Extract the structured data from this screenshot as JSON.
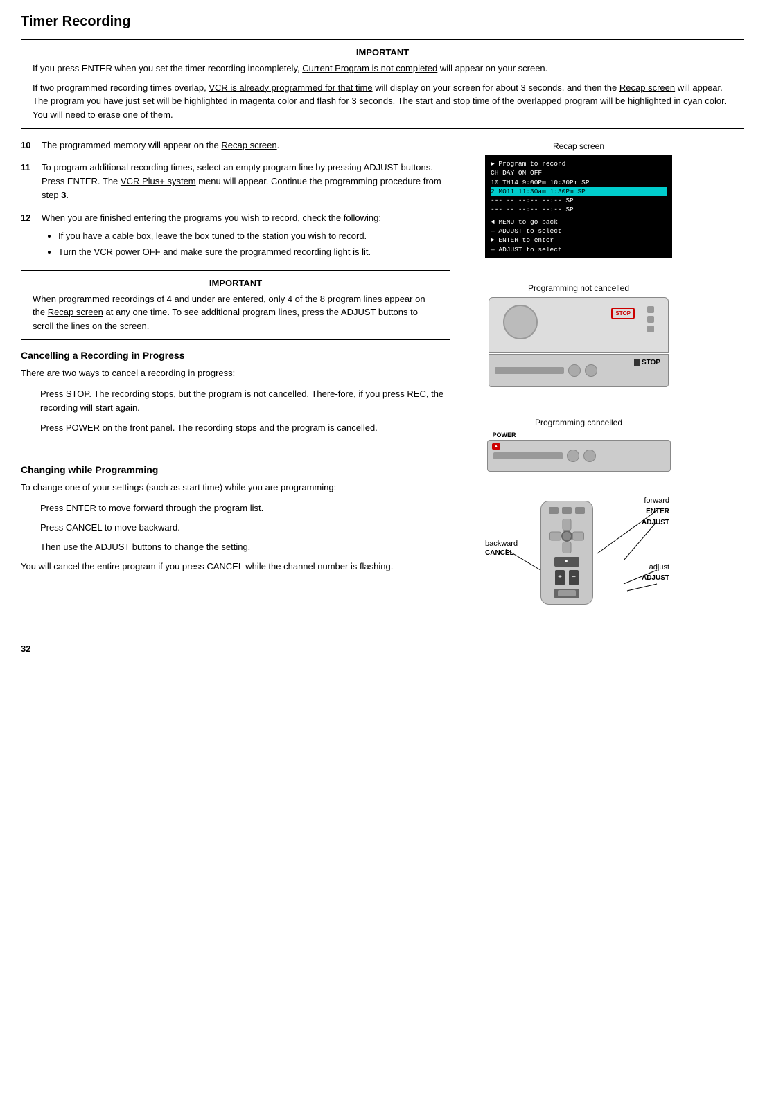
{
  "page": {
    "title": "Timer Recording",
    "page_number": "32"
  },
  "important_box_1": {
    "title": "IMPORTANT",
    "para1": "If you press ENTER when you set the timer recording incompletely, Current Program is not completed will appear on your screen.",
    "para1_underline": "Current Program is not completed",
    "para2_prefix": "If two programmed recording times overlap, ",
    "para2_underline": "VCR is already programmed for that time",
    "para2_mid": " will display on your screen for about 3 seconds, and then the ",
    "para2_underline2": "Recap screen",
    "para2_suffix": " will appear.  The program you have just set will be highlighted in magenta color and flash for 3 seconds.  The start and stop time of the overlapped program will be highlighted in cyan color.  You will need to erase one of them."
  },
  "steps": {
    "step10_num": "10",
    "step10_text": "The programmed memory will appear on the ",
    "step10_underline": "Recap screen",
    "step10_suffix": ".",
    "step11_num": "11",
    "step11_prefix": "To program additional recording times, select an empty program line by pressing ADJUST buttons.  Press ENTER.  The ",
    "step11_underline": "VCR Plus+ system",
    "step11_suffix": " menu will appear.  Continue the programming procedure from step ",
    "step11_bold": "3",
    "step11_end": ".",
    "step12_num": "12",
    "step12_text": "When you are finished entering the programs you wish to record, check the following:",
    "step12_bullet1": "If you have a cable box, leave the box tuned to the station you wish to record.",
    "step12_bullet2": "Turn the VCR power OFF and make sure the programmed recording light is lit."
  },
  "important_box_2": {
    "title": "IMPORTANT",
    "text": "When programmed recordings of 4 and under are entered, only 4 of the 8 program lines appear on the ",
    "underline": "Recap screen",
    "suffix": " at any one time.  To see additional program lines, press the ADJUST buttons to scroll the lines on the screen."
  },
  "cancelling_section": {
    "heading": "Cancelling a Recording in Progress",
    "intro": "There are two ways to cancel a recording in progress:",
    "method1": "Press STOP.  The recording stops, but the program is not cancelled.  There-fore, if you press REC, the recording will start again.",
    "method2": "Press POWER on the front panel.  The recording stops and the program is cancelled."
  },
  "changing_section": {
    "heading": "Changing while Programming",
    "intro": "To change one of your settings (such as start time) while you are programming:",
    "line1": "Press ENTER to move forward through the program list.",
    "line2": "Press CANCEL to move backward.",
    "line3": "Then use the ADJUST buttons to change the setting.",
    "note": "You will cancel the entire program if you press CANCEL while the channel number is flashing."
  },
  "right_col": {
    "recap_label": "Recap screen",
    "prog_not_cancelled_label": "Programming not cancelled",
    "prog_cancelled_label": "Programming cancelled",
    "stop_label": "STOP",
    "power_label": "POWER",
    "forward_label": "forward",
    "backward_label": "backward",
    "enter_label": "ENTER",
    "adjust_label": "ADJUST",
    "adjust_lower_label": "adjust",
    "adjust_lower2": "ADJUST",
    "cancel_label": "CANCEL"
  },
  "recap_screen": {
    "line1": "Program to record",
    "col_headers": " CH DAY   ON      OFF",
    "row1": " 10 TH14  9:00Pm  10:30Pm SP",
    "row2_highlight": " 2  MO11 11:30am   1:30Pm SP",
    "row3": "--- --   --:--   --:-- SP",
    "row4": "--- --   --:--   --:-- SP",
    "menu1": "MENU to go back",
    "menu2": "ADJUST to select",
    "menu3": "ENTER  to enter",
    "menu4": "ADJUST to select"
  }
}
